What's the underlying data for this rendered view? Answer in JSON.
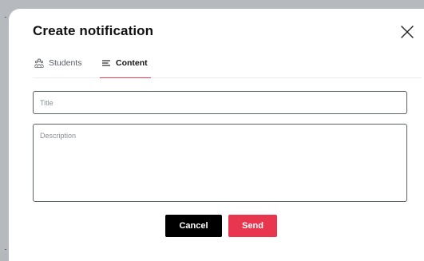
{
  "dialog": {
    "title": "Create notification",
    "close_icon": "close-icon"
  },
  "tabs": [
    {
      "label": "Students",
      "icon": "students-icon",
      "active": false
    },
    {
      "label": "Content",
      "icon": "list-icon",
      "active": true
    }
  ],
  "form": {
    "title_placeholder": "Title",
    "title_value": "",
    "description_placeholder": "Description",
    "description_value": ""
  },
  "actions": {
    "cancel_label": "Cancel",
    "send_label": "Send"
  },
  "colors": {
    "accent": "#e8364f",
    "cancel_bg": "#000000",
    "backdrop": "#b3b8bd"
  }
}
